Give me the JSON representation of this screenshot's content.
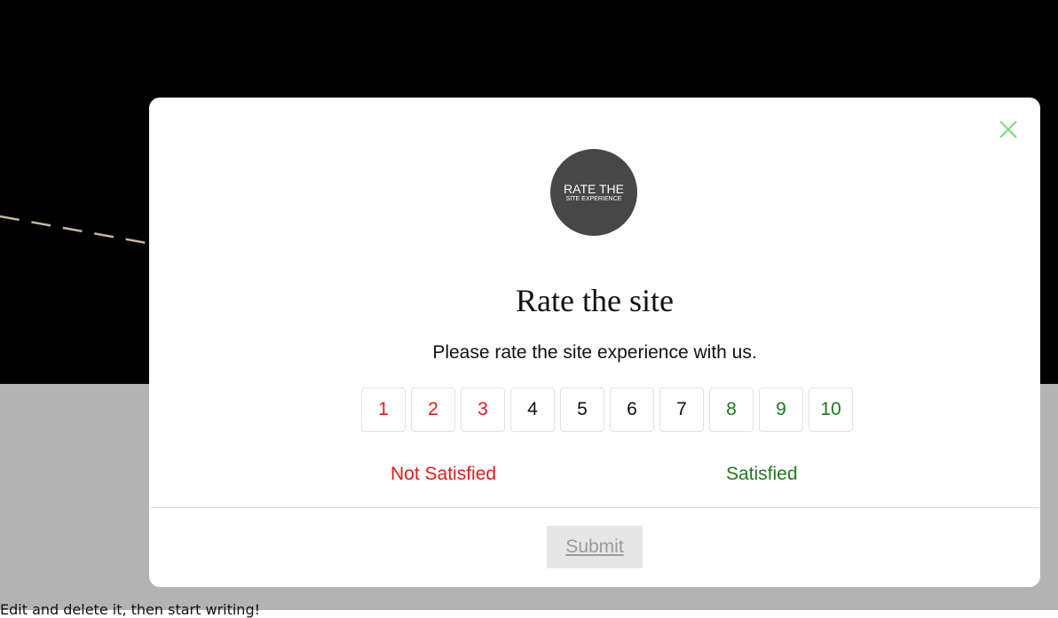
{
  "background": {
    "partial_text": "Edit and delete it, then start writing!",
    "colors": {
      "top": "#000000",
      "bottom": "#b3b3b3"
    }
  },
  "modal": {
    "close_icon": "close-icon",
    "logo": {
      "line1": "RATE THE",
      "line2": "SITE EXPERIENCE"
    },
    "title": "Rate the site",
    "subtitle": "Please rate the site experience with us.",
    "ratings": [
      {
        "label": "1",
        "tone": "red"
      },
      {
        "label": "2",
        "tone": "red"
      },
      {
        "label": "3",
        "tone": "red"
      },
      {
        "label": "4",
        "tone": "black"
      },
      {
        "label": "5",
        "tone": "black"
      },
      {
        "label": "6",
        "tone": "black"
      },
      {
        "label": "7",
        "tone": "black"
      },
      {
        "label": "8",
        "tone": "green"
      },
      {
        "label": "9",
        "tone": "green"
      },
      {
        "label": "10",
        "tone": "green"
      }
    ],
    "scale_low_label": "Not Satisfied",
    "scale_high_label": "Satisfied",
    "submit_label": "Submit",
    "colors": {
      "negative": "#e21b1b",
      "positive": "#1d7a1d",
      "close": "#7ddc7d"
    }
  }
}
